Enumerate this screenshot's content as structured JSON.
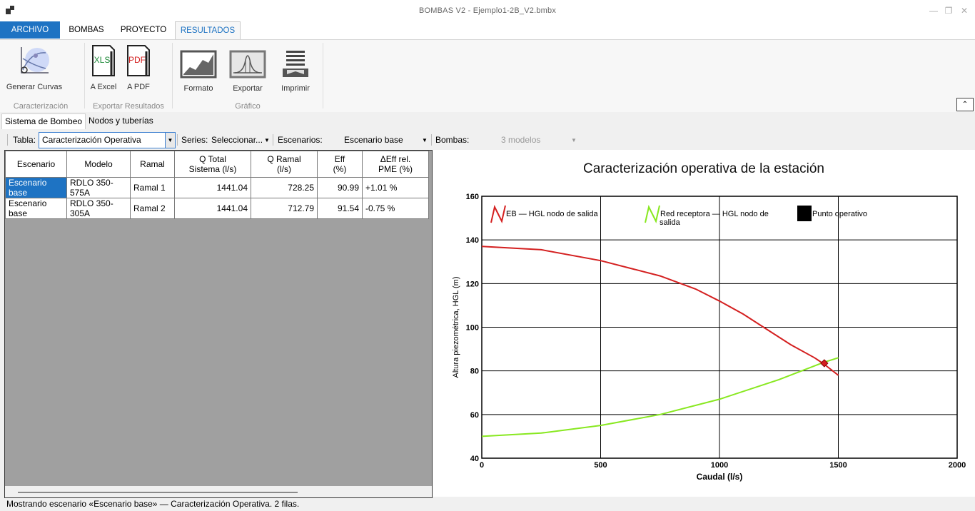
{
  "window": {
    "title": "BOMBAS V2 - Ejemplo1-2B_V2.bmbx"
  },
  "menu": {
    "tabs": [
      {
        "label": "ARCHIVO"
      },
      {
        "label": "BOMBAS"
      },
      {
        "label": "PROYECTO"
      },
      {
        "label": "RESULTADOS"
      }
    ]
  },
  "ribbon": {
    "groups": [
      {
        "label": "Caracterización"
      },
      {
        "label": "Exportar Resultados"
      },
      {
        "label": "Gráfico"
      }
    ],
    "buttons": {
      "generar": "Generar Curvas",
      "excel": "A Excel",
      "excel_icon_text": "XLS",
      "pdf": "A PDF",
      "pdf_icon_text": "PDF",
      "formato": "Formato",
      "exportar": "Exportar",
      "imprimir": "Imprimir"
    }
  },
  "doc_tabs": [
    {
      "label": "Sistema de Bombeo"
    },
    {
      "label": "Nodos y tuberías"
    }
  ],
  "toolbar": {
    "tabla_label": "Tabla:",
    "tabla_value": "Caracterización Operativa",
    "series_label": "Series:",
    "series_value": "Seleccionar...",
    "escenarios_label": "Escenarios:",
    "escenarios_value": "Escenario base",
    "bombas_label": "Bombas:",
    "bombas_value": "3 modelos"
  },
  "table": {
    "headers": [
      {
        "l1": "Escenario",
        "l2": ""
      },
      {
        "l1": "Modelo",
        "l2": ""
      },
      {
        "l1": "Ramal",
        "l2": ""
      },
      {
        "l1": "Q Total",
        "l2": "Sistema (l/s)"
      },
      {
        "l1": "Q Ramal",
        "l2": "(l/s)"
      },
      {
        "l1": "Eff",
        "l2": "(%)"
      },
      {
        "l1": "ΔEff rel.",
        "l2": "PME (%)"
      }
    ],
    "rows": [
      [
        "Escenario base",
        "RDLO 350-575A",
        "Ramal 1",
        "1441.04",
        "728.25",
        "90.99",
        "+1.01 %"
      ],
      [
        "Escenario base",
        "RDLO 350-305A",
        "Ramal 2",
        "1441.04",
        "712.79",
        "91.54",
        "-0.75 %"
      ]
    ]
  },
  "status": {
    "text": "Mostrando escenario «Escenario base» — Caracterización Operativa. 2 filas."
  },
  "chart_data": {
    "type": "line",
    "title": "Caracterización operativa de la estación",
    "xlabel": "Caudal (l/s)",
    "ylabel": "Altura piezométrica, HGL (m)",
    "xlim": [
      0,
      2000
    ],
    "ylim": [
      40,
      160
    ],
    "xticks": [
      0,
      500,
      1000,
      1500,
      2000
    ],
    "yticks": [
      40,
      60,
      80,
      100,
      120,
      140,
      160
    ],
    "grid": true,
    "legend_position": "top",
    "series": [
      {
        "name": "EB — HGL nodo de salida",
        "color": "#d42020",
        "x": [
          0,
          250,
          500,
          750,
          900,
          1000,
          1100,
          1200,
          1300,
          1400,
          1441.04,
          1500
        ],
        "y": [
          137,
          135.5,
          130.5,
          123.5,
          117.5,
          112,
          106,
          99,
          92,
          86,
          83,
          78
        ]
      },
      {
        "name": "Red receptora — HGL nodo de salida",
        "color": "#88e820",
        "x": [
          0,
          250,
          500,
          750,
          1000,
          1250,
          1441.04,
          1500
        ],
        "y": [
          50,
          51.5,
          55,
          60,
          67,
          76,
          84,
          86
        ]
      }
    ],
    "operating_point": {
      "name": "Punto operativo",
      "x": 1441.04,
      "y": 83.5,
      "color": "#d42020"
    }
  }
}
